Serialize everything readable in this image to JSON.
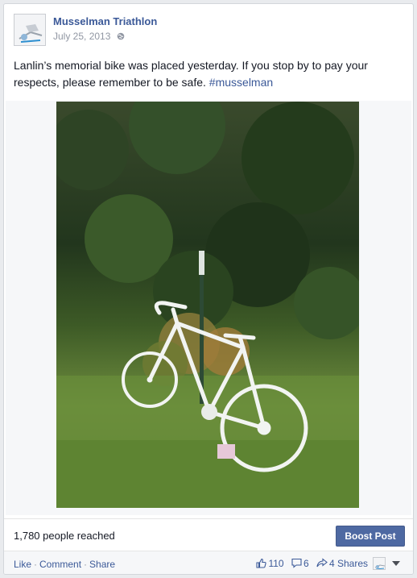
{
  "post": {
    "page_name": "Musselman Triathlon",
    "date": "July 25, 2013",
    "audience_icon": "globe-icon",
    "text": "Lanlin’s memorial bike was placed yesterday. If you stop by to pay your respects, please remember to be safe.",
    "hashtag": "#musselman",
    "photo": "white ghost bike leaning on a post in tall grass before dense green bushes"
  },
  "reach": {
    "text": "1,780 people reached",
    "boost_label": "Boost Post"
  },
  "actions": {
    "like": "Like",
    "comment": "Comment",
    "share": "Share",
    "separator": "·"
  },
  "stats": {
    "likes": "110",
    "comments": "6",
    "shares": "4 Shares"
  },
  "colors": {
    "link": "#3b5998",
    "boost": "#4e69a2",
    "meta": "#9197a3"
  }
}
